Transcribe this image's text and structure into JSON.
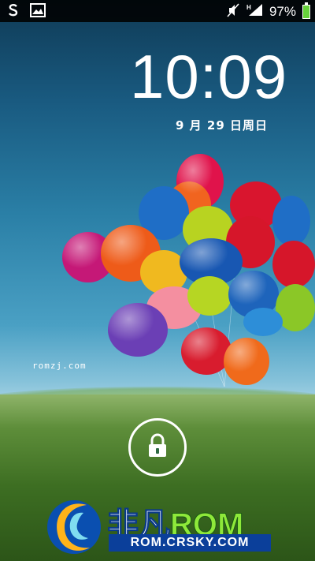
{
  "status_bar": {
    "left_icons": [
      "s-logo-icon",
      "image-icon"
    ],
    "right_icons": [
      "mute-icon",
      "signal-h-icon",
      "battery-icon"
    ],
    "network_type": "H",
    "battery_text": "97%",
    "battery_level": 0.97,
    "battery_color": "#66d13b"
  },
  "lockscreen": {
    "time": "10:09",
    "date": "9 月 29 日周日",
    "watermark": "romzj.com",
    "unlock_icon": "padlock-icon"
  },
  "brand": {
    "title_cn": "非凡",
    "title_rom": "ROM",
    "url": "ROM.CRSKY.COM"
  }
}
